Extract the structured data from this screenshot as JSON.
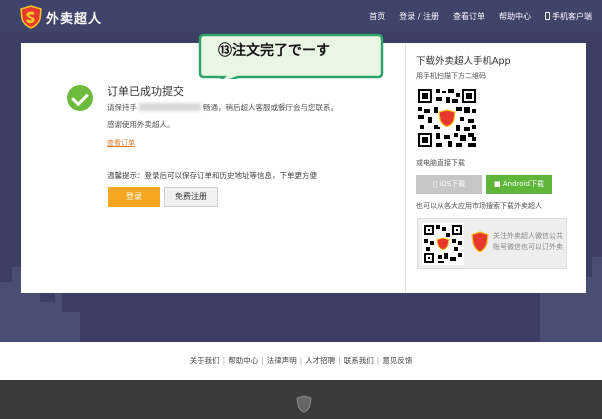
{
  "brand": {
    "name": "外卖超人"
  },
  "nav": {
    "items": [
      "首页",
      "登录 / 注册",
      "查看订单",
      "帮助中心"
    ],
    "app_link": "手机客户端"
  },
  "order": {
    "title": "订单已成功提交",
    "line1_prefix": "请保持手",
    "line1_suffix": "畅通，稍后超人客服或餐厅会与您联系。",
    "line2": "感谢使用外卖超人。",
    "view_order_link": "查看订单",
    "tip": "温馨提示：登录后可以保存订单和历史地址等信息，下单更方便",
    "login_button": "登录",
    "register_button": "免费注册"
  },
  "app_panel": {
    "title": "下载外卖超人手机App",
    "scan_text": "用手机扫描下方二维码",
    "direct_download": "或电脑直接下载",
    "ios_button": "iOS下载",
    "android_button": "Android下载",
    "store_text": "也可以从各大应用市场搜索下载外卖超人",
    "wechat_text": "关注外卖超人微信公共账号微信也可以订外卖"
  },
  "annotation": {
    "text": "⑬注文完了でーす"
  },
  "footer": {
    "links": [
      "关于我们",
      "帮助中心",
      "法律声明",
      "人才招聘",
      "联系我们",
      "意见反馈"
    ]
  },
  "colors": {
    "header_bg": "#41446a",
    "accent_orange": "#f5a623",
    "success_green": "#6dbb3c",
    "android_green": "#5fb63b",
    "bubble_green": "#2ea46b"
  }
}
